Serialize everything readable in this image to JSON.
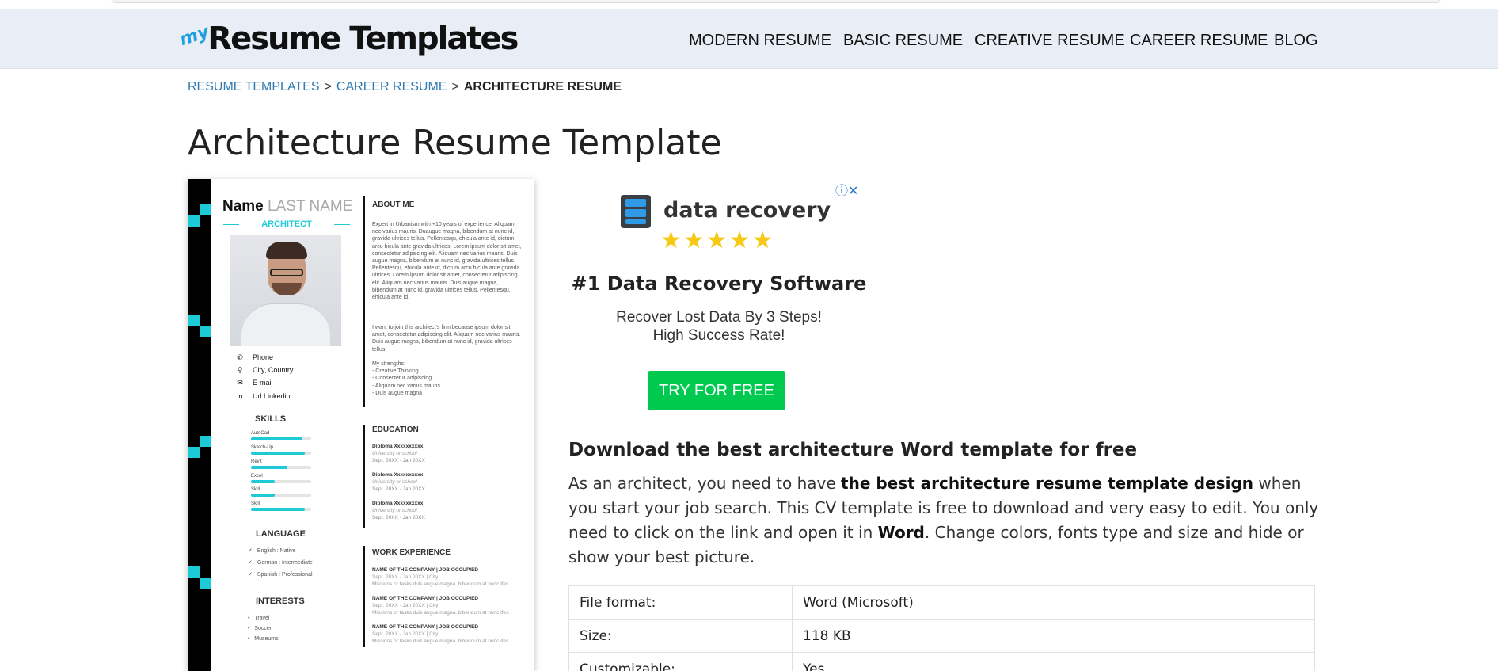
{
  "header": {
    "logo_my": "my",
    "logo_text": "Resume Templates",
    "nav": [
      "MODERN RESUME",
      "BASIC RESUME",
      "CREATIVE RESUME",
      "CAREER RESUME",
      "BLOG"
    ]
  },
  "breadcrumb": {
    "items": [
      "RESUME TEMPLATES",
      "CAREER RESUME"
    ],
    "current": "ARCHITECTURE RESUME",
    "separator": ">"
  },
  "page_title": "Architecture Resume Template",
  "resume_preview": {
    "first_name": "Name",
    "last_name": "LAST NAME",
    "role": "ARCHITECT",
    "contacts": [
      {
        "icon": "phone-icon",
        "glyph": "✆",
        "label": "Phone"
      },
      {
        "icon": "location-pin-icon",
        "glyph": "⚲",
        "label": "City, Country"
      },
      {
        "icon": "mail-icon",
        "glyph": "✉",
        "label": "E-mail"
      },
      {
        "icon": "linkedin-icon",
        "glyph": "in",
        "label": "Url Linkedin"
      }
    ],
    "skills_heading": "SKILLS",
    "skills": [
      {
        "name": "AutoCad",
        "level": 0.85
      },
      {
        "name": "Sketch-Up",
        "level": 0.9
      },
      {
        "name": "Revit",
        "level": 0.6
      },
      {
        "name": "Excel",
        "level": 0.4
      },
      {
        "name": "Skill",
        "level": 0.4
      },
      {
        "name": "Skill",
        "level": 0.9
      }
    ],
    "language_heading": "LANGUAGE",
    "languages": [
      "English : Native",
      "German : Intermediate",
      "Spanish : Professional"
    ],
    "interests_heading": "INTERESTS",
    "interests": [
      "Travel",
      "Soccer",
      "Museums"
    ],
    "about_heading": "ABOUT ME",
    "about_text_1": "Expert in Urbanism with +10 years of experience. Aliquam nec varius mauris. Duaugue magna, bibendum at nunc id, gravida ultrices tellus. Pellentesqu, ehicula ante id, dictum arcu hicula ante gravida ultrices. Lorem ipsum dolor sit amet, consectetur adipiscing elit. Aliquam nec varius mauris. Duis augue magna, bibendum at nunc id, gravida ultrices tellus. Pellentesqu, ehicula ante id, dictum arcu hicula ante gravida ultrices. Lorem ipsum dolor sit amet, consectetur adipiscing elit. Aliquam nec varius mauris. Duis augue magna, bibendum at nunc id, gravida ultrices tellus. Pellentesqu, ehicula ante id.",
    "about_text_2": "I want to join this architect's firm because ipsum dolor sit amet, consectetur adipiscing elit. Aliquam nec varius mauris. Duis augue magna, bibendum at nunc id, gravida ultrices tellus.",
    "strengths_title": "My strengths:",
    "strengths": [
      "- Creative Thinking",
      "- Consectetur adipiscing",
      "- Aliquam nec varius mauris",
      "- Duis augue magna"
    ],
    "education_heading": "EDUCATION",
    "education": [
      {
        "title": "Diploma Xxxxxxxxxx",
        "school": "University or school",
        "dates": "Sept. 20XX - Jan 20XX"
      },
      {
        "title": "Diploma Xxxxxxxxxx",
        "school": "University or school",
        "dates": "Sept. 20XX - Jan 20XX"
      },
      {
        "title": "Diploma Xxxxxxxxxx",
        "school": "University or school",
        "dates": "Sept. 20XX - Jan 20XX"
      }
    ],
    "work_heading": "WORK EXPERIENCE",
    "work": [
      {
        "title": "NAME OF THE COMPANY | JOB OCCUPIED",
        "dates": "Sept. 20XX - Jan 20XX | City",
        "desc": "Missions or tasks duis augue magna, bibendum at nunc ifes."
      },
      {
        "title": "NAME OF THE COMPANY | JOB OCCUPIED",
        "dates": "Sept. 20XX - Jan 20XX | City",
        "desc": "Missions or tasks duis augue magna, bibendum at nunc ifes."
      },
      {
        "title": "NAME OF THE COMPANY | JOB OCCUPIED",
        "dates": "Sept. 20XX - Jan 20XX | City",
        "desc": "Missions or tasks duis augue magna, bibendum at nunc ifes."
      }
    ]
  },
  "ad": {
    "choice_icons": "ⓘ✕",
    "brand": "data recovery",
    "stars": "★★★★★",
    "rating": 5,
    "headline": "#1 Data Recovery Software",
    "sub_line_1": "Recover Lost Data By 3 Steps!",
    "sub_line_2": "High Success Rate!",
    "cta": "TRY FOR FREE"
  },
  "description": {
    "heading": "Download the best architecture Word template for free",
    "p_1": "As an architect, you need to have ",
    "p_bold_1": "the best architecture resume template design",
    "p_2": " when you start your job search. This CV template is free to download and very easy to edit. You only need to click on the link and open it in ",
    "p_bold_2": "Word",
    "p_3": ". Change colors, fonts type and size and hide or show your best picture."
  },
  "info_table": [
    {
      "key": "File format:",
      "value": "Word (Microsoft)"
    },
    {
      "key": "Size:",
      "value": "118 KB"
    },
    {
      "key": "Customizable:",
      "value": "Yes"
    }
  ],
  "colors": {
    "header_bg": "#e8edf6",
    "link": "#2f7ab0",
    "accent_cyan": "#1ccbd6",
    "ad_button": "#00c94f",
    "star": "#f6c915",
    "adchoice": "#1e73c8"
  }
}
